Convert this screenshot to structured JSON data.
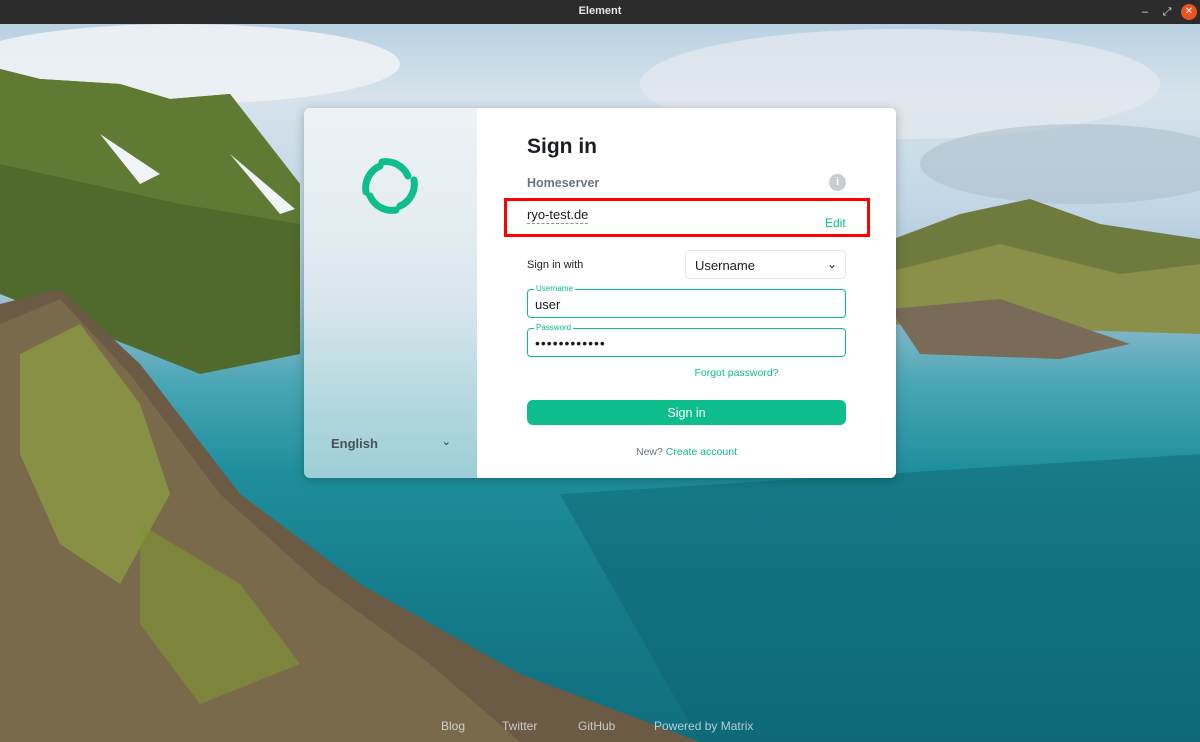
{
  "window": {
    "title": "Element",
    "minimize": "–",
    "maximize": "⤢",
    "close": "✕"
  },
  "login": {
    "title": "Sign in",
    "homeserver_label": "Homeserver",
    "info_icon": "i",
    "homeserver_value": "ryo-test.de",
    "edit_label": "Edit",
    "sign_in_with_label": "Sign in with",
    "sign_in_with_value": "Username",
    "username_label": "Username",
    "username_value": "user",
    "password_label": "Password",
    "password_value": "••••••••••••",
    "forgot_password": "Forgot password?",
    "submit_label": "Sign in",
    "new_prompt": "New?",
    "create_account": "Create account"
  },
  "sidebar": {
    "language": "English",
    "chevron": "⌄"
  },
  "footer": {
    "links": [
      "Blog",
      "Twitter",
      "GitHub",
      "Powered by Matrix"
    ]
  },
  "colors": {
    "accent": "#0dbd8b",
    "highlight": "#ff0000",
    "close_button": "#e95420"
  }
}
